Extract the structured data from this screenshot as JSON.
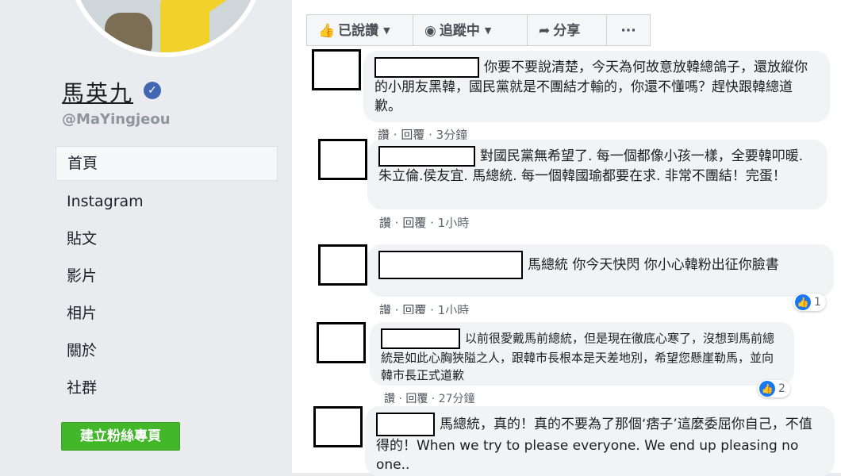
{
  "profile": {
    "name": "馬英九",
    "handle": "@MaYingjeou"
  },
  "nav": {
    "items": [
      "首頁",
      "Instagram",
      "貼文",
      "影片",
      "相片",
      "關於",
      "社群"
    ],
    "create_button": "建立粉絲專頁"
  },
  "actions": {
    "liked": "已說讚",
    "following": "追蹤中",
    "share": "分享",
    "more": "···"
  },
  "comments": [
    {
      "text": "你要不要說清楚，今天為何故意放韓總鴿子，還放縱你的小朋友黑韓，國民黨就是不團結才輸的，你還不懂嗎？趕快跟韓總道歉。",
      "like": "讚",
      "reply": "回覆",
      "time": "3分鐘",
      "reactions": ""
    },
    {
      "text": "對國民黨無希望了. 每一個都像小孩一樣，全要韓叩暖. 朱立倫.侯友宜. 馬總統. 每一個韓國瑜都要在求. 非常不團結！完蛋！",
      "like": "讚",
      "reply": "回覆",
      "time": "1小時",
      "reactions": ""
    },
    {
      "text": "馬總統 你今天快閃 你小心韓粉出征你臉書",
      "like": "讚",
      "reply": "回覆",
      "time": "1小時",
      "reactions": "1"
    },
    {
      "text": "以前很愛戴馬前總統，但是現在徹底心寒了，沒想到馬前總統是如此心胸狹隘之人，跟韓市長根本是天差地別，希望您懸崖勒馬，並向韓市長正式道歉",
      "like": "讚",
      "reply": "回覆",
      "time": "27分鐘",
      "reactions": "2"
    },
    {
      "text": "馬總統，真的！真的不要為了那個‘痞子’這麼委屈你自己，不值得的！When we try to please everyone. We end up pleasing no one..",
      "like": "",
      "reply": "",
      "time": "",
      "reactions": ""
    }
  ]
}
